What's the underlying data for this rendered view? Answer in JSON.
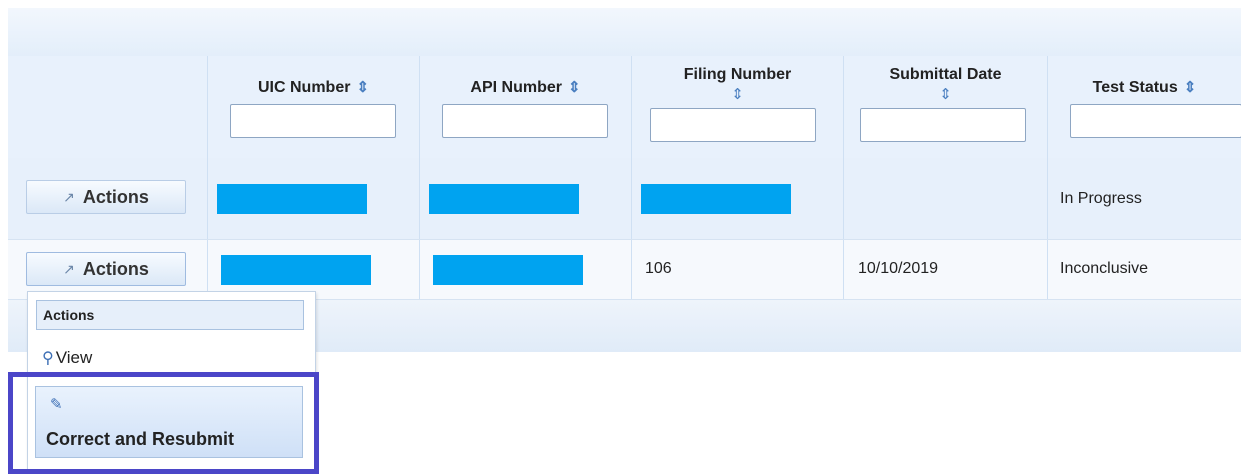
{
  "columns": [
    {
      "label": "UIC Number",
      "sort_icon": "sort-icon"
    },
    {
      "label": "API Number",
      "sort_icon": "sort-icon"
    },
    {
      "label": "Filing Number",
      "sort_icon": "sort-icon"
    },
    {
      "label": "Submittal Date",
      "sort_icon": "sort-icon"
    },
    {
      "label": "Test Status",
      "sort_icon": "sort-icon"
    }
  ],
  "rows": [
    {
      "action_label": "Actions",
      "filing_number": "",
      "submittal_date": "",
      "test_status": "In Progress"
    },
    {
      "action_label": "Actions",
      "filing_number": "106",
      "submittal_date": "10/10/2019",
      "test_status": "Inconclusive"
    }
  ],
  "menu": {
    "header": "Actions",
    "items": [
      {
        "label": "View",
        "icon": "magnifier-icon"
      },
      {
        "label": "Correct and Resubmit",
        "icon": "pencil-icon"
      }
    ]
  },
  "colors": {
    "highlight": "#4b46c8",
    "redaction": "#00a3f0",
    "header_bg": "#e8f1fc"
  }
}
